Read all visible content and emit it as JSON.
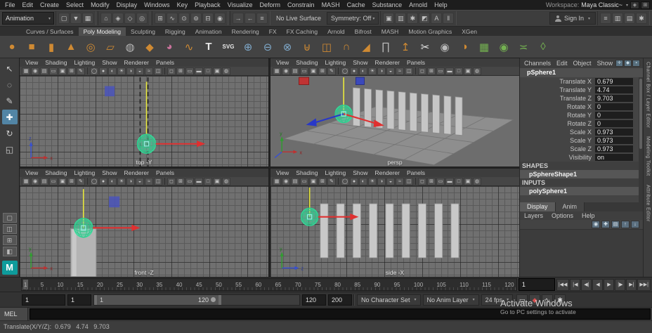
{
  "menubar": {
    "items": [
      "File",
      "Edit",
      "Create",
      "Select",
      "Modify",
      "Display",
      "Windows",
      "Key",
      "Playback",
      "Visualize",
      "Deform",
      "Constrain",
      "MASH",
      "Cache",
      "Substance",
      "Arnold",
      "Help"
    ],
    "workspace_label": "Workspace:",
    "workspace_value": "Maya Classic~",
    "right_icons": [
      "workspace-lock-icon",
      "workspace-layout-icon"
    ]
  },
  "statusline": {
    "mode": "Animation",
    "no_live_surface": "No Live Surface",
    "symmetry": "Symmetry: Off",
    "sign_in": "Sign In",
    "icon_groups": [
      [
        "new-scene-icon",
        "open-scene-icon",
        "save-scene-icon"
      ],
      [
        "select-by-hierarchy-icon",
        "select-by-object-icon",
        "select-by-component-icon",
        "highlight-selection-icon"
      ],
      [
        "snap-to-grid-icon",
        "snap-to-curve-icon",
        "snap-to-point-icon",
        "snap-to-projected-center-icon",
        "snap-to-view-plane-icon",
        "make-object-live-icon"
      ],
      [
        "input-connections-icon",
        "output-connections-icon",
        "construction-history-icon"
      ],
      [
        "render-frame-icon",
        "ipr-render-icon",
        "render-settings-icon",
        "hypershade-icon",
        "arnold-renderview-icon",
        "pause-viewport-icon"
      ],
      [
        "outliner-toggle-icon",
        "channel-box-toggle-icon",
        "attribute-editor-toggle-icon",
        "tool-settings-toggle-icon"
      ]
    ]
  },
  "shelf": {
    "active_tab": "Poly Modeling",
    "tabs": [
      "Curves / Surfaces",
      "Poly Modeling",
      "Sculpting",
      "Rigging",
      "Animation",
      "Rendering",
      "FX",
      "FX Caching",
      "Arnold",
      "Bifrost",
      "MASH",
      "Motion Graphics",
      "XGen"
    ],
    "icons": [
      {
        "name": "poly-sphere-icon",
        "color": "#cf8a33"
      },
      {
        "name": "poly-cube-icon",
        "color": "#cf8a33"
      },
      {
        "name": "poly-cylinder-icon",
        "color": "#cf8a33"
      },
      {
        "name": "poly-cone-icon",
        "color": "#cf8a33"
      },
      {
        "name": "poly-torus-icon",
        "color": "#cf8a33"
      },
      {
        "name": "poly-plane-icon",
        "color": "#cf8a33"
      },
      {
        "name": "poly-disc-icon",
        "color": "#b9b9b9"
      },
      {
        "name": "poly-platonic-icon",
        "color": "#cf8a33"
      },
      {
        "name": "sculpt-tool-icon",
        "color": "#c9729b"
      },
      {
        "name": "poly-helix-icon",
        "color": "#cf8a33"
      },
      {
        "name": "type-tool-icon",
        "color": "#e8e8e8"
      },
      {
        "name": "svg-tool-icon",
        "color": "#e8e8e8"
      },
      {
        "name": "boolean-union-icon",
        "color": "#7fa8c9"
      },
      {
        "name": "boolean-difference-icon",
        "color": "#7fa8c9"
      },
      {
        "name": "boolean-intersection-icon",
        "color": "#7fa8c9"
      },
      {
        "name": "combine-icon",
        "color": "#cf8a33"
      },
      {
        "name": "separate-icon",
        "color": "#cf8a33"
      },
      {
        "name": "smooth-icon",
        "color": "#cf8a33"
      },
      {
        "name": "bevel-icon",
        "color": "#cf8a33"
      },
      {
        "name": "bridge-icon",
        "color": "#b9b9b9"
      },
      {
        "name": "extrude-icon",
        "color": "#cf8a33"
      },
      {
        "name": "multi-cut-icon",
        "color": "#e8e8e8"
      },
      {
        "name": "target-weld-icon",
        "color": "#b9b9b9"
      },
      {
        "name": "mirror-icon",
        "color": "#cf8a33"
      },
      {
        "name": "quad-draw-icon",
        "color": "#74b151"
      },
      {
        "name": "make-live-icon",
        "color": "#74b151"
      },
      {
        "name": "connect-icon",
        "color": "#74b151"
      },
      {
        "name": "shrinkwrap-icon",
        "color": "#74b151"
      }
    ]
  },
  "left_toolbar": {
    "tools": [
      {
        "name": "select-tool",
        "active": false
      },
      {
        "name": "lasso-tool",
        "active": false
      },
      {
        "name": "paint-select-tool",
        "active": false
      },
      {
        "name": "move-tool",
        "active": true
      },
      {
        "name": "rotate-tool",
        "active": false
      },
      {
        "name": "scale-tool",
        "active": false
      }
    ],
    "layouts": [
      "single-pane-layout",
      "two-pane-layout",
      "four-pane-layout",
      "persp-outliner-layout"
    ],
    "logo_text": "M"
  },
  "viewports": {
    "menus": [
      "View",
      "Shading",
      "Lighting",
      "Show",
      "Renderer",
      "Panels"
    ],
    "toolbar_icons": [
      "select-camera-icon",
      "lock-camera-icon",
      "camera-attributes-icon",
      "bookmark-icon",
      "image-plane-icon",
      "2d-pan-zoom-icon",
      "grease-pencil-icon",
      "wireframe-icon",
      "shaded-icon",
      "textured-icon",
      "use-all-lights-icon",
      "shadows-icon",
      "ambient-occlusion-icon",
      "motion-blur-icon",
      "symmetry-icon",
      "isolate-select-icon",
      "field-chart-icon",
      "resolution-gate-icon",
      "gate-mask-icon",
      "safe-action-icon",
      "safe-title-icon",
      "xray-icon"
    ],
    "panels": [
      {
        "label": "top -Y",
        "axis_h": "x",
        "axis_v": "z"
      },
      {
        "label": "persp",
        "axis_h": "x",
        "axis_v": "y"
      },
      {
        "label": "front -Z",
        "axis_h": "x",
        "axis_v": "y"
      },
      {
        "label": "side -X",
        "axis_h": "z",
        "axis_v": "y"
      }
    ]
  },
  "channel_box": {
    "menus": [
      "Channels",
      "Edit",
      "Object",
      "Show"
    ],
    "header_icons": [
      "channel-manipulator-icon",
      "channel-key-icon",
      "channel-settings-icon"
    ],
    "object_name": "pSphere1",
    "attributes": [
      {
        "name": "Translate X",
        "value": "0.679"
      },
      {
        "name": "Translate Y",
        "value": "4.74"
      },
      {
        "name": "Translate Z",
        "value": "9.703"
      },
      {
        "name": "Rotate X",
        "value": "0"
      },
      {
        "name": "Rotate Y",
        "value": "0"
      },
      {
        "name": "Rotate Z",
        "value": "0"
      },
      {
        "name": "Scale X",
        "value": "0.973"
      },
      {
        "name": "Scale Y",
        "value": "0.973"
      },
      {
        "name": "Scale Z",
        "value": "0.973"
      },
      {
        "name": "Visibility",
        "value": "on"
      }
    ],
    "shapes_label": "SHAPES",
    "shape_name": "pSphereShape1",
    "inputs_label": "INPUTS",
    "input_name": "polySphere1",
    "layer_tabs": [
      "Display",
      "Anim"
    ],
    "layer_menus": [
      "Layers",
      "Options",
      "Help"
    ],
    "layer_icons": [
      "toggle-layer-visibility-icon",
      "add-empty-layer-icon",
      "add-layer-from-selected-icon",
      "move-layer-up-icon",
      "move-layer-down-icon"
    ]
  },
  "right_dock": {
    "tabs": [
      "Channel Box / Layer Editor",
      "Modeling Toolkit",
      "Attribute Editor"
    ]
  },
  "timeline": {
    "ticks": [
      "1",
      "5",
      "10",
      "15",
      "20",
      "25",
      "30",
      "35",
      "40",
      "45",
      "50",
      "55",
      "60",
      "65",
      "70",
      "75",
      "80",
      "85",
      "90",
      "95",
      "100",
      "105",
      "110",
      "115",
      "120"
    ],
    "current_frame": "1",
    "transport": [
      {
        "name": "go-to-start-button",
        "glyph": "|◀◀"
      },
      {
        "name": "step-back-key-button",
        "glyph": "|◀"
      },
      {
        "name": "step-back-frame-button",
        "glyph": "◀|"
      },
      {
        "name": "play-backward-button",
        "glyph": "◀"
      },
      {
        "name": "play-forward-button",
        "glyph": "▶"
      },
      {
        "name": "step-forward-frame-button",
        "glyph": "|▶"
      },
      {
        "name": "step-forward-key-button",
        "glyph": "▶|"
      },
      {
        "name": "go-to-end-button",
        "glyph": "▶▶|"
      }
    ]
  },
  "range_slider": {
    "animation_start": "1",
    "playback_start": "1",
    "slider_start_label": "1",
    "slider_end_label": "120",
    "playback_end": "120",
    "animation_end": "200",
    "character_set": "No Character Set",
    "anim_layer": "No Anim Layer",
    "fps": "24 fps",
    "icons": [
      "speech-bubble-icon",
      "auto-key-icon",
      "default-tangent-icon",
      "animation-preferences-icon"
    ]
  },
  "command_line": {
    "label": "MEL",
    "value": ""
  },
  "help_line": {
    "text": "Translate(X/Y/Z):  0.679   4.74   9.703"
  },
  "watermark": {
    "line1": "Activate Windows",
    "line2": "Go to PC settings to activate"
  },
  "colors": {
    "maya_teal": "#0e9b9b",
    "selection_green": "#2fe09a",
    "manipulator_red": "#e03030",
    "manipulator_yellow": "#e6e63c",
    "manipulator_blue": "#2838c8"
  }
}
